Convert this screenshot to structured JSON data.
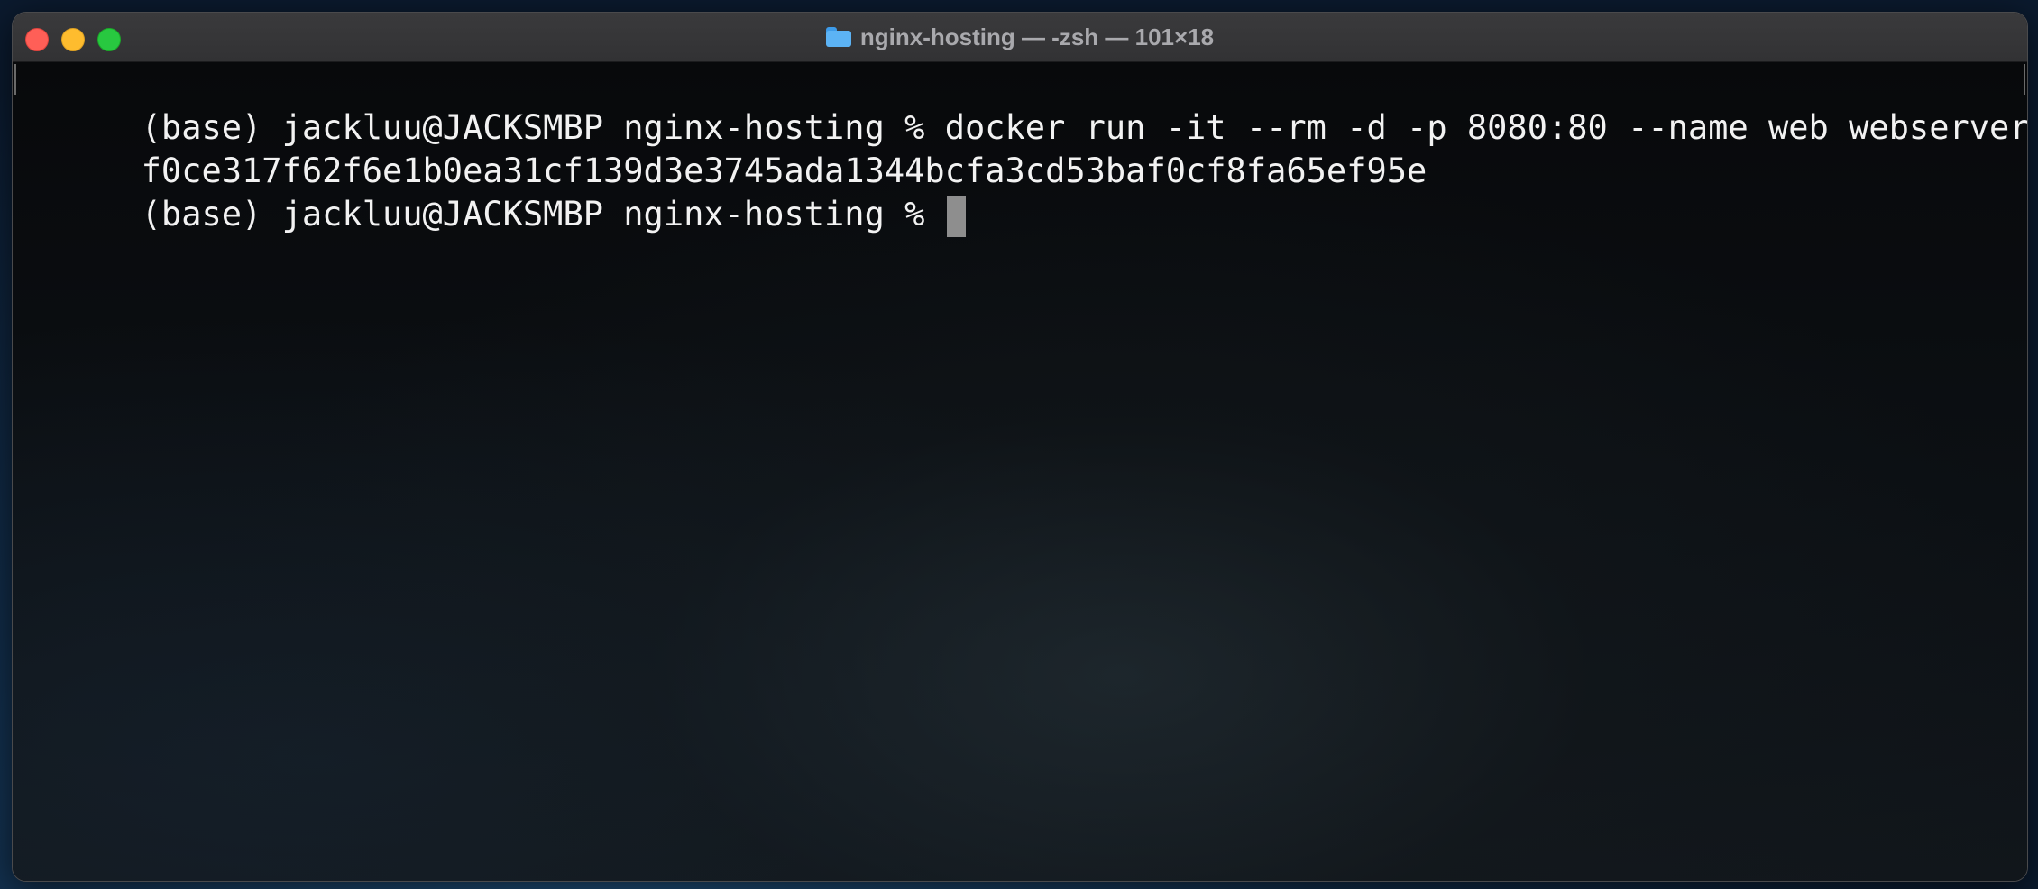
{
  "window": {
    "title": "nginx-hosting — -zsh — 101×18",
    "title_icon": "folder-icon",
    "buttons": {
      "close_color": "#ff5f57",
      "minimize_color": "#febc2e",
      "zoom_color": "#28c840"
    }
  },
  "terminal": {
    "lines": [
      {
        "text": "(base) jackluu@JACKSMBP nginx-hosting % docker run -it --rm -d -p 8080:80 --name web webserver"
      },
      {
        "text": "f0ce317f62f6e1b0ea31cf139d3e3745ada1344bcfa3cd53baf0cf8fa65ef95e"
      },
      {
        "text": "(base) jackluu@JACKSMBP nginx-hosting % "
      }
    ],
    "text_color": "#f2f2f2",
    "cursor_color": "#8e8e8e"
  }
}
